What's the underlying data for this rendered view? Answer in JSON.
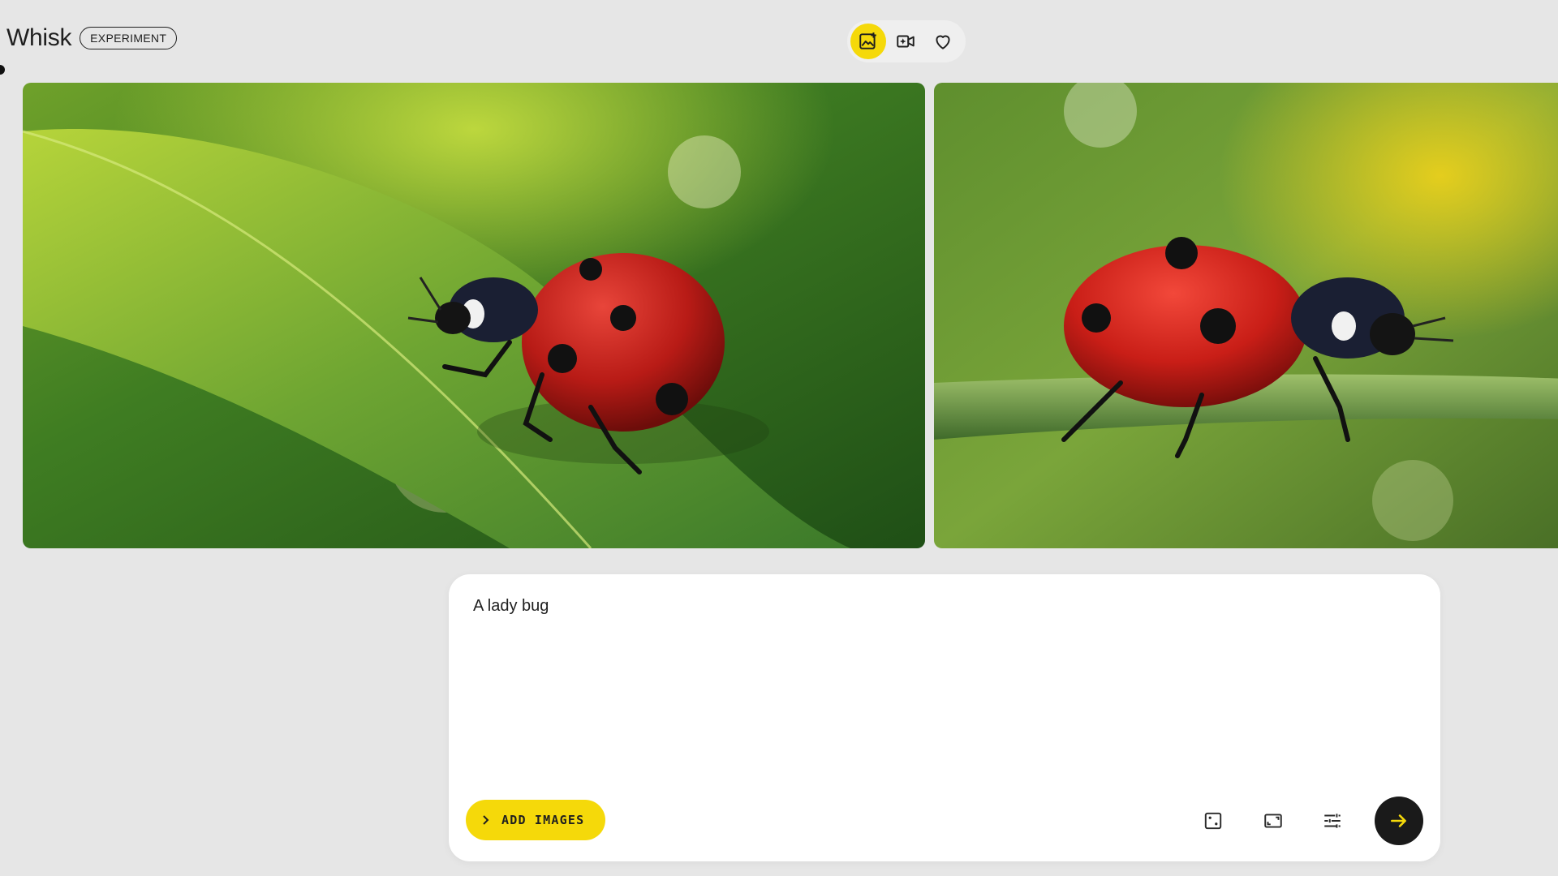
{
  "header": {
    "app_name": "Whisk",
    "badge": "EXPERIMENT"
  },
  "mode_switch": [
    {
      "icon": "add-image-icon",
      "active": true
    },
    {
      "icon": "animate-video-icon",
      "active": false
    },
    {
      "icon": "heart-icon",
      "active": false
    }
  ],
  "gallery": [
    {
      "subject": "ladybug on leaf",
      "accent": "#c8201b"
    },
    {
      "subject": "ladybug on grass blade",
      "accent": "#d0231d"
    }
  ],
  "prompt": {
    "value": "A lady bug",
    "add_images_label": "ADD IMAGES",
    "tools": [
      "dice-icon",
      "aspect-ratio-icon",
      "tune-icon"
    ],
    "submit_icon": "arrow-right-icon"
  },
  "colors": {
    "accent": "#f5d90a",
    "background": "#e6e6e6",
    "submit": "#1a1a1a"
  }
}
